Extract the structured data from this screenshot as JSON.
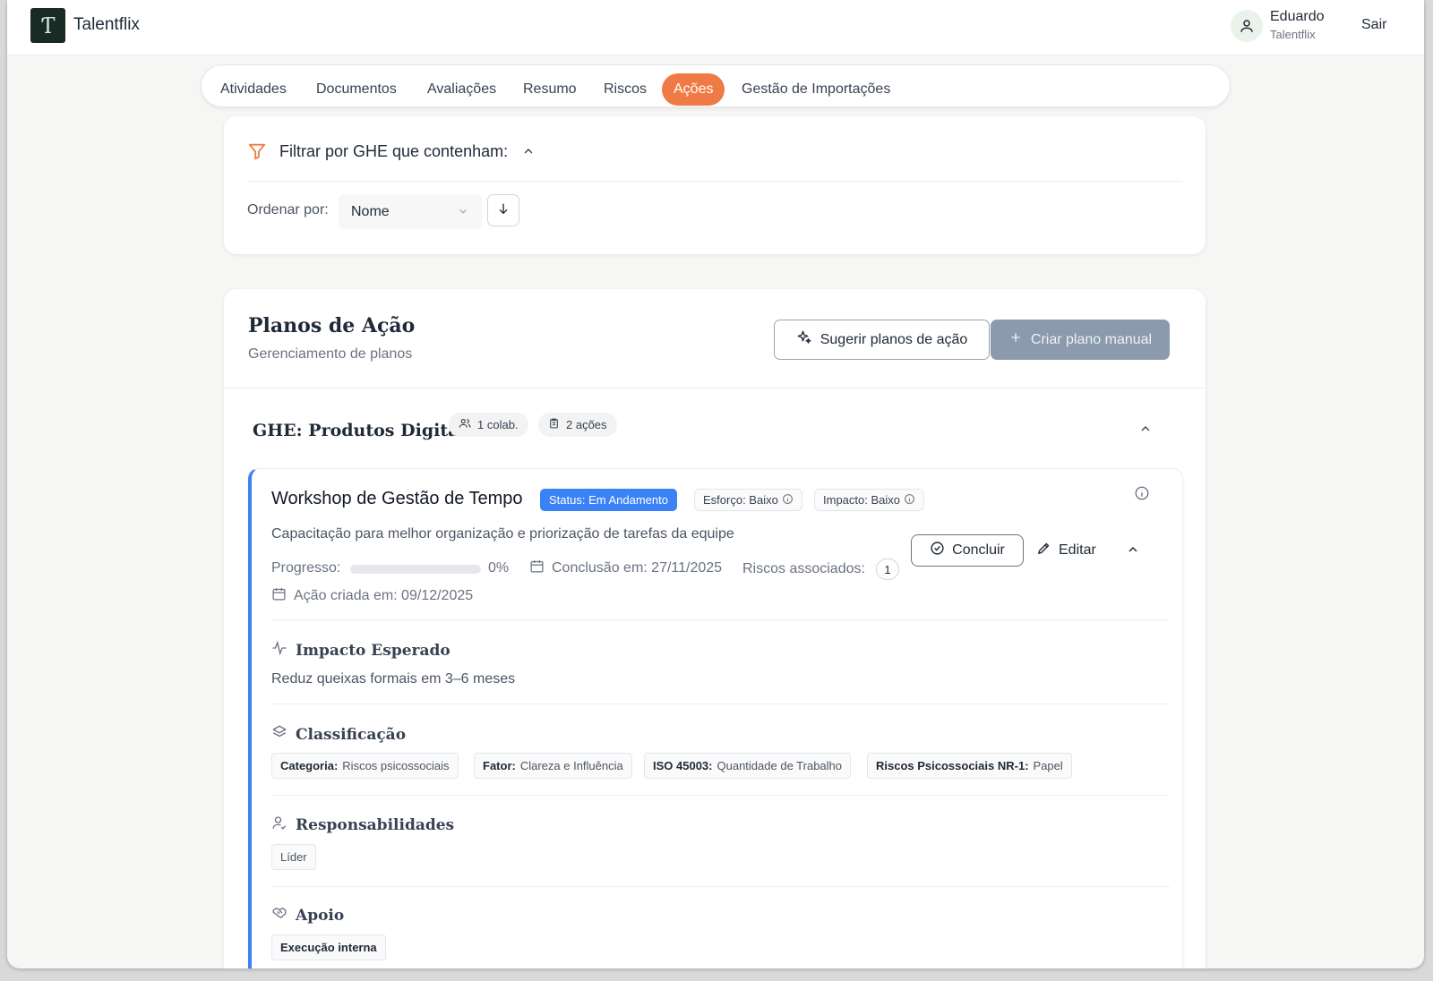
{
  "app": {
    "brand": "Talentflix",
    "logo_glyph": "Ƭ"
  },
  "user": {
    "name": "Eduardo",
    "org": "Talentflix",
    "logout": "Sair"
  },
  "tabs": [
    {
      "label": "Atividades"
    },
    {
      "label": "Documentos"
    },
    {
      "label": "Avaliações"
    },
    {
      "label": "Resumo"
    },
    {
      "label": "Riscos"
    },
    {
      "label": "Ações",
      "active": true
    },
    {
      "label": "Gestão de Importações"
    }
  ],
  "filter": {
    "title": "Filtrar por GHE que contenham:",
    "sort_label": "Ordenar por:",
    "sort_value": "Nome",
    "sort_direction": "descending"
  },
  "plans": {
    "title": "Planos de Ação",
    "subtitle": "Gerenciamento de planos",
    "suggest_button": "Sugerir planos de ação",
    "create_button": "Criar plano manual"
  },
  "ghe": {
    "title": "GHE: Produtos Digitais",
    "collaborators": "1 colab.",
    "actions": "2 ações"
  },
  "action": {
    "title": "Workshop de Gestão de Tempo",
    "status": "Status: Em Andamento",
    "effort": "Esforço: Baixo",
    "impact": "Impacto: Baixo",
    "description": "Capacitação para melhor organização e priorização de tarefas da equipe",
    "progress_label": "Progresso:",
    "progress_value": 0,
    "progress_text": "0%",
    "conclusion": "Conclusão em: 27/11/2025",
    "risks_label": "Riscos associados:",
    "risks_count": "1",
    "created": "Ação criada em: 09/12/2025",
    "conclude_button": "Concluir",
    "edit_button": "Editar"
  },
  "impact_section": {
    "title": "Impacto Esperado",
    "text": "Reduz queixas formais em 3–6 meses"
  },
  "classification": {
    "title": "Classificação",
    "tags": [
      {
        "key": "Categoria:",
        "value": "Riscos psicossociais"
      },
      {
        "key": "Fator:",
        "value": "Clareza e Influência"
      },
      {
        "key": "ISO 45003:",
        "value": "Quantidade de Trabalho"
      },
      {
        "key": "Riscos Psicossociais NR-1:",
        "value": "Papel"
      }
    ]
  },
  "responsibilities": {
    "title": "Responsabilidades",
    "tag": "Líder"
  },
  "support": {
    "title": "Apoio",
    "tag": "Execução interna"
  },
  "colors": {
    "accent": "#f07a45",
    "status_blue": "#3b82f6",
    "brand_dark": "#1a2b25"
  }
}
